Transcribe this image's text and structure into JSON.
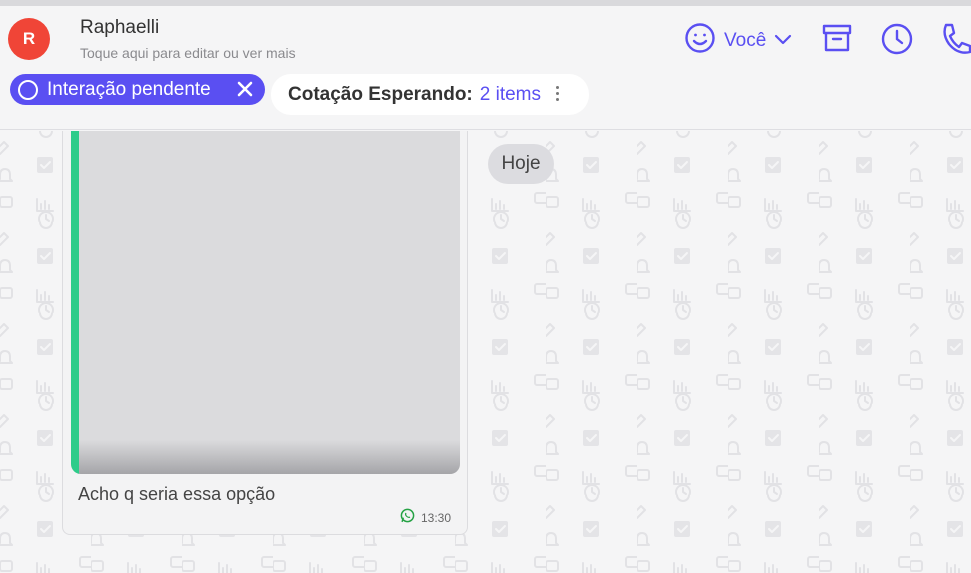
{
  "contact": {
    "initial": "R",
    "name": "Raphaelli",
    "subtitle": "Toque aqui para editar ou ver mais",
    "avatar_color": "#f04537"
  },
  "header_actions": {
    "assignee_label": "Você",
    "icons": [
      "smiley-icon",
      "chevron-down-icon",
      "archive-icon",
      "clock-icon",
      "phone-icon"
    ]
  },
  "tags": {
    "pending": {
      "label": "Interação pendente",
      "icon": "ring-icon",
      "close_icon": "close-icon"
    },
    "quote": {
      "label": "Cotação Esperando:",
      "count": "2 items",
      "menu_icon": "kebab-menu-icon"
    }
  },
  "chat": {
    "day_separator": "Hoje",
    "messages": [
      {
        "type": "image",
        "caption": "Acho q seria essa opção",
        "time": "13:30",
        "channel_icon": "whatsapp-icon"
      }
    ]
  },
  "colors": {
    "accent": "#5a4ff2",
    "media_bar": "#2ecc8a",
    "whatsapp": "#25a244",
    "background": "#f5f5f6"
  }
}
